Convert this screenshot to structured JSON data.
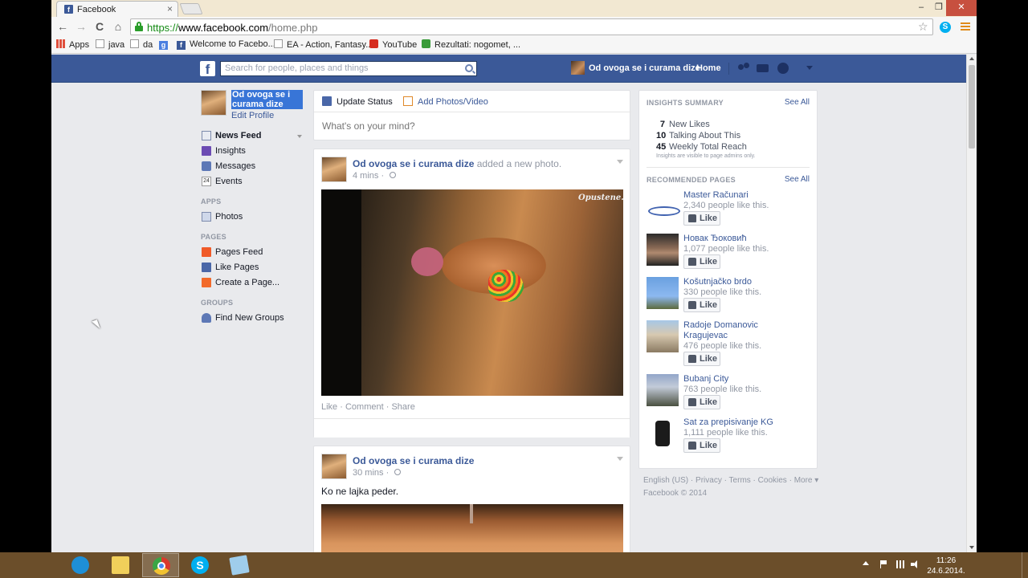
{
  "browser": {
    "tab_title": "Facebook",
    "tab_close": "×",
    "window_min": "–",
    "window_max": "❐",
    "window_close": "✕",
    "url_scheme": "https://",
    "url_host": "www.facebook.com",
    "url_path": "/home.php",
    "nav_back": "←",
    "nav_forward": "→",
    "nav_reload": "C",
    "nav_home": "⌂",
    "star": "☆",
    "skype_ext": "S",
    "bookmarks": [
      {
        "label": "Apps",
        "icon": "apps-grid-icon"
      },
      {
        "label": "java",
        "icon": "page-icon"
      },
      {
        "label": "da",
        "icon": "page-icon"
      },
      {
        "label": "",
        "icon": "google-icon"
      },
      {
        "label": "Welcome to Facebo...",
        "icon": "facebook-icon"
      },
      {
        "label": "EA - Action, Fantasy...",
        "icon": "page-icon"
      },
      {
        "label": "YouTube",
        "icon": "youtube-icon"
      },
      {
        "label": "Rezultati: nogomet, ...",
        "icon": "rezultati-icon"
      }
    ]
  },
  "fb": {
    "logo": "f",
    "search_placeholder": "Search for people, places and things",
    "user_name": "Od ovoga se i curama dize",
    "home": "Home",
    "left_nav": {
      "profile_name": "Od ovoga se i curama dize",
      "edit_profile": "Edit Profile",
      "main_items": [
        "News Feed",
        "Insights",
        "Messages",
        "Events"
      ],
      "events_icon_text": "24",
      "apps_header": "APPS",
      "apps_items": [
        "Photos"
      ],
      "pages_header": "PAGES",
      "pages_items": [
        "Pages Feed",
        "Like Pages",
        "Create a Page..."
      ],
      "groups_header": "GROUPS",
      "groups_items": [
        "Find New Groups"
      ]
    },
    "composer": {
      "update_status": "Update Status",
      "add_photos": "Add Photos/Video",
      "placeholder": "What's on your mind?"
    },
    "posts": [
      {
        "author": "Od ovoga se i curama dize",
        "action": "added a new photo.",
        "time": "4 mins",
        "photo_watermark": "Opustene.rs",
        "actions": [
          "Like",
          "Comment",
          "Share"
        ]
      },
      {
        "author": "Od ovoga se i curama dize",
        "action": "",
        "time": "30 mins",
        "text": "Ko ne lajka peder."
      }
    ],
    "insights": {
      "header": "INSIGHTS SUMMARY",
      "see_all": "See All",
      "stats": [
        {
          "value": "7",
          "label": "New Likes"
        },
        {
          "value": "10",
          "label": "Talking About This"
        },
        {
          "value": "45",
          "label": "Weekly Total Reach"
        }
      ],
      "note": "Insights are visible to page admins only."
    },
    "recommended": {
      "header": "RECOMMENDED PAGES",
      "see_all": "See All",
      "like_label": "Like",
      "pages": [
        {
          "name": "Master Računari",
          "likes": "2,340 people like this."
        },
        {
          "name": "Новак Ђоковић",
          "likes": "1,077 people like this."
        },
        {
          "name": "Košutnjačko brdo",
          "likes": "330 people like this."
        },
        {
          "name": "Radoje Domanovic Kragujevac",
          "likes": "476 people like this."
        },
        {
          "name": "Bubanj City",
          "likes": "763 people like this."
        },
        {
          "name": "Sat za prepisivanje KG",
          "likes": "1,111 people like this."
        }
      ]
    },
    "footer": {
      "links": [
        "English (US)",
        "Privacy",
        "Terms",
        "Cookies",
        "More ▾"
      ],
      "copyright": "Facebook © 2014"
    }
  },
  "taskbar": {
    "time": "11:26",
    "date": "24.6.2014."
  }
}
